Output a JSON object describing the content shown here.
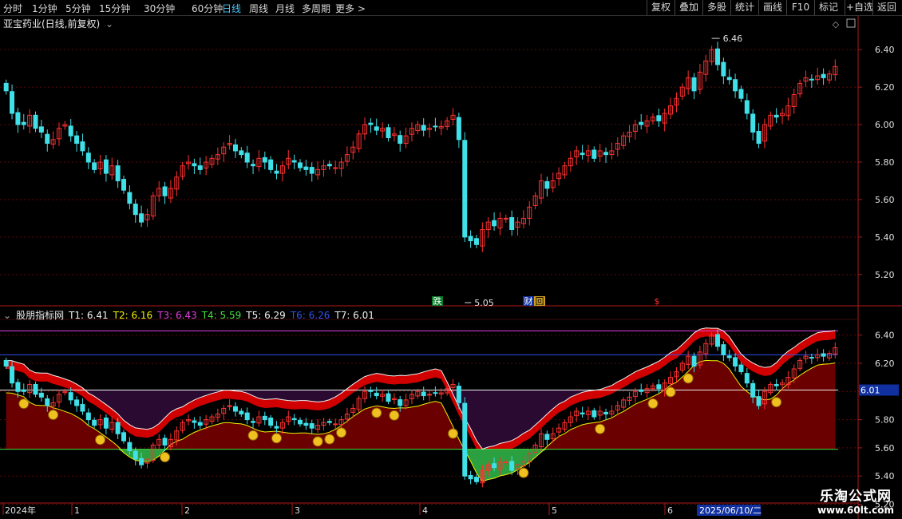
{
  "toolbar": {
    "periods": [
      "分时",
      "1分钟",
      "5分钟",
      "15分钟",
      "30分钟",
      "60分钟",
      "日线",
      "周线",
      "月线",
      "多周期",
      "更多 >"
    ],
    "active_period": "日线",
    "right_buttons": [
      "复权",
      "叠加",
      "多股",
      "统计",
      "画线",
      "F10",
      "+自选",
      "返回"
    ],
    "right_label": "标记"
  },
  "stock": {
    "title": "亚宝药业(日线,前复权)"
  },
  "chart_data": [
    {
      "type": "candlestick",
      "title": "亚宝药业(日线,前复权)",
      "ylim": [
        5.08,
        6.52
      ],
      "yticks": [
        "6.40",
        "6.20",
        "6.00",
        "5.80",
        "5.60",
        "5.40",
        "5.20"
      ],
      "ytick_values": [
        6.4,
        6.2,
        6.0,
        5.8,
        5.6,
        5.4,
        5.2
      ],
      "annotations": {
        "high": "6.46",
        "low": "5.05",
        "labels": [
          "跌",
          "财",
          "回",
          "$"
        ]
      },
      "up_color": "#ff3030",
      "down_color": "#40e0e8",
      "close": [
        6.18,
        6.06,
        6.0,
        6.0,
        6.05,
        5.98,
        5.96,
        5.9,
        5.92,
        5.98,
        6.0,
        5.94,
        5.9,
        5.86,
        5.8,
        5.76,
        5.8,
        5.74,
        5.78,
        5.7,
        5.65,
        5.58,
        5.52,
        5.48,
        5.52,
        5.62,
        5.66,
        5.62,
        5.66,
        5.72,
        5.78,
        5.8,
        5.78,
        5.76,
        5.8,
        5.82,
        5.84,
        5.88,
        5.9,
        5.86,
        5.84,
        5.8,
        5.78,
        5.82,
        5.8,
        5.76,
        5.74,
        5.78,
        5.82,
        5.8,
        5.77,
        5.76,
        5.74,
        5.76,
        5.78,
        5.78,
        5.77,
        5.8,
        5.84,
        5.88,
        5.95,
        6.0,
        6.0,
        5.97,
        5.98,
        5.93,
        5.95,
        5.9,
        5.94,
        5.98,
        6.0,
        5.97,
        5.98,
        5.99,
        5.99,
        6.02,
        6.05,
        5.92,
        5.4,
        5.38,
        5.36,
        5.44,
        5.48,
        5.46,
        5.5,
        5.5,
        5.44,
        5.48,
        5.5,
        5.56,
        5.62,
        5.7,
        5.66,
        5.7,
        5.74,
        5.78,
        5.82,
        5.86,
        5.84,
        5.86,
        5.82,
        5.86,
        5.84,
        5.86,
        5.9,
        5.94,
        5.96,
        6.0,
        6.0,
        6.02,
        6.04,
        6.02,
        6.06,
        6.1,
        6.14,
        6.2,
        6.25,
        6.18,
        6.28,
        6.34,
        6.4,
        6.32,
        6.26,
        6.24,
        6.18,
        6.14,
        6.06,
        5.96,
        5.9,
        6.0,
        6.05,
        6.04,
        6.06,
        6.1,
        6.16,
        6.22,
        6.25,
        6.24,
        6.26,
        6.25,
        6.27,
        6.31
      ]
    },
    {
      "type": "indicator",
      "name": "股朋指标网",
      "ylim": [
        5.22,
        6.5
      ],
      "yticks": [
        "6.40",
        "6.20",
        "6.00",
        "5.80",
        "5.60",
        "5.40",
        "5.20"
      ],
      "ytick_values": [
        6.4,
        6.2,
        6.0,
        5.8,
        5.6,
        5.4,
        5.2
      ],
      "current_value_tag": "6.01",
      "series": [
        {
          "name": "T1",
          "value": "6.41",
          "color": "#f0f0f0"
        },
        {
          "name": "T2",
          "value": "6.16",
          "color": "#f0f000"
        },
        {
          "name": "T3",
          "value": "6.43",
          "color": "#e040e0"
        },
        {
          "name": "T4",
          "value": "5.59",
          "color": "#40e040"
        },
        {
          "name": "T5",
          "value": "6.29",
          "color": "#f0f0f0"
        },
        {
          "name": "T6",
          "value": "6.26",
          "color": "#3050f0"
        },
        {
          "name": "T7",
          "value": "6.01",
          "color": "#f0f0f0"
        }
      ],
      "x_axis": [
        "2024年",
        "1",
        "2",
        "3",
        "4",
        "5",
        "6"
      ],
      "x_highlight": "2025/06/10/二"
    }
  ],
  "watermark": {
    "line1": "乐淘公式网",
    "line2": "www.60lt.com"
  }
}
